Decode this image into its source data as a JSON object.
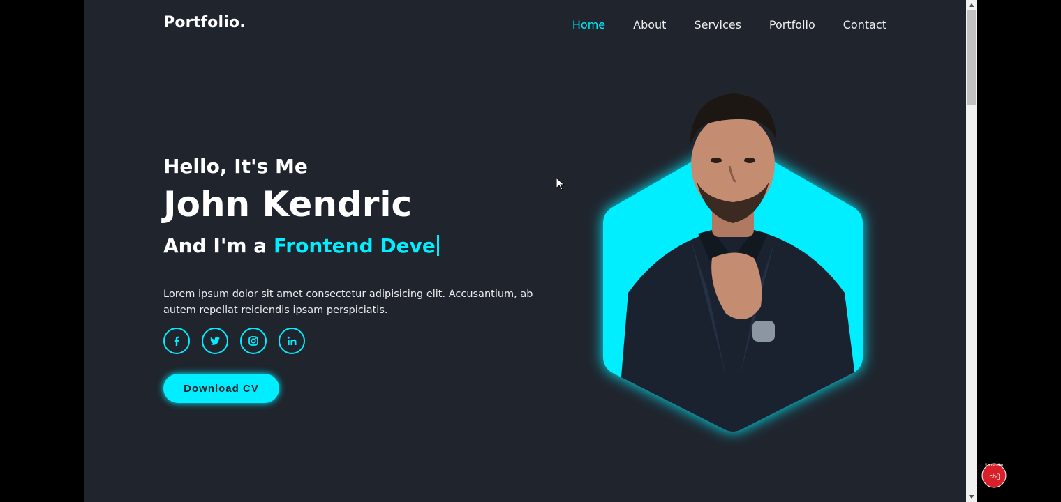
{
  "header": {
    "logo": "Portfolio.",
    "nav": [
      {
        "label": "Home",
        "active": true
      },
      {
        "label": "About",
        "active": false
      },
      {
        "label": "Services",
        "active": false
      },
      {
        "label": "Portfolio",
        "active": false
      },
      {
        "label": "Contact",
        "active": false
      }
    ]
  },
  "hero": {
    "greeting": "Hello, It's Me",
    "name": "John Kendric",
    "role_prefix": "And I'm a ",
    "role_typed": "Frontend Deve",
    "description": "Lorem ipsum dolor sit amet consectetur adipisicing elit. Accusantium, ab autem repellat reiciendis ipsam perspiciatis.",
    "socials": [
      {
        "icon": "facebook-icon"
      },
      {
        "icon": "twitter-icon"
      },
      {
        "icon": "instagram-icon"
      },
      {
        "icon": "linkedin-icon"
      }
    ],
    "cta_label": "Download CV"
  },
  "badge": {
    "text_top": "Subscribe",
    "text_main": ".ch{}"
  },
  "colors": {
    "background": "#1f242d",
    "accent": "#00eeff",
    "text": "#ededed"
  }
}
